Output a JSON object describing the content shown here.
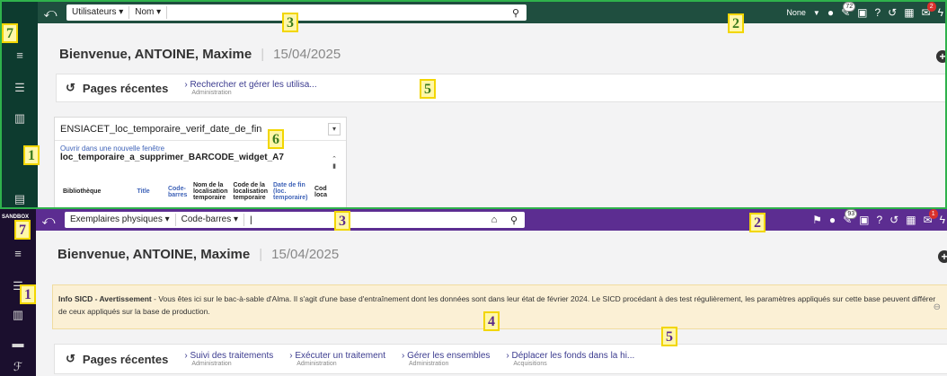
{
  "top": {
    "search": {
      "type_select": "Utilisateurs ▾",
      "field_select": "Nom ▾",
      "value": "",
      "placeholder": ""
    },
    "toolbar": {
      "location_text": "None",
      "badge_tasks": "72",
      "badge_notifications": "2"
    },
    "welcome": {
      "name": "Bienvenue, ANTOINE, Maxime",
      "date": "15/04/2025"
    },
    "recent": {
      "title": "Pages récentes",
      "items": [
        {
          "label": "Rechercher et gérer les utilisa...",
          "sub": "Administration"
        }
      ]
    },
    "widget": {
      "title": "ENSIACET_loc_temporaire_verif_date_de_fin",
      "open_link": "Ouvrir dans une nouvelle fenêtre",
      "report_name": "loc_temporaire_a_supprimer_BARCODE_widget_A7",
      "columns": [
        "Bibliothèque",
        "Title",
        "Code-barres",
        "Nom de la localisation temporaire",
        "Code de la localisation temporaire",
        "Date de fin (loc. temporaire)",
        "Cod loca"
      ]
    },
    "labels": {
      "l1": "1",
      "l2": "2",
      "l3": "3",
      "l5": "5",
      "l6": "6",
      "l7": "7"
    }
  },
  "bottom": {
    "sandbox": "SANDBOX",
    "search": {
      "type_select": "Exemplaires physiques ▾",
      "field_select": "Code-barres ▾",
      "value": "|",
      "placeholder": ""
    },
    "toolbar": {
      "badge_tasks": "93",
      "badge_notifications": "1"
    },
    "welcome": {
      "name": "Bienvenue, ANTOINE, Maxime",
      "date": "15/04/2025"
    },
    "info": {
      "bold": "Info SICD - Avertissement",
      "text": " - Vous êtes ici sur le bac-à-sable d'Alma. Il s'agit d'une base d'entraînement dont les données sont dans leur état de février 2024. Le SICD procédant à des test régulièrement, les paramètres appliqués sur cette base peuvent différer de ceux appliqués sur la base de production."
    },
    "recent": {
      "title": "Pages récentes",
      "items": [
        {
          "label": "Suivi des traitements",
          "sub": "Administration"
        },
        {
          "label": "Exécuter un traitement",
          "sub": "Administration"
        },
        {
          "label": "Gérer les ensembles",
          "sub": "Administration"
        },
        {
          "label": "Déplacer les fonds dans la hi...",
          "sub": "Acquisitions"
        }
      ]
    },
    "labels": {
      "l1": "1",
      "l2": "2",
      "l3": "3",
      "l4": "4",
      "l5": "5",
      "l7": "7"
    }
  },
  "colors": {
    "top_bar": "#1f4e3f",
    "top_sidebar": "#0d3b2f",
    "bottom_bar": "#5c2d91",
    "bottom_sidebar": "#1b0f2e",
    "info_bg": "#fbf0d5",
    "highlight": "#f2d600"
  },
  "icons": [
    "back-icon",
    "search-icon",
    "user-icon",
    "tasks-icon",
    "clipboard-icon",
    "help-icon",
    "history-icon",
    "grid-icon",
    "notification-icon",
    "bolt-icon",
    "location-icon",
    "home-icon",
    "plus-icon",
    "history-icon",
    "close-icon"
  ]
}
